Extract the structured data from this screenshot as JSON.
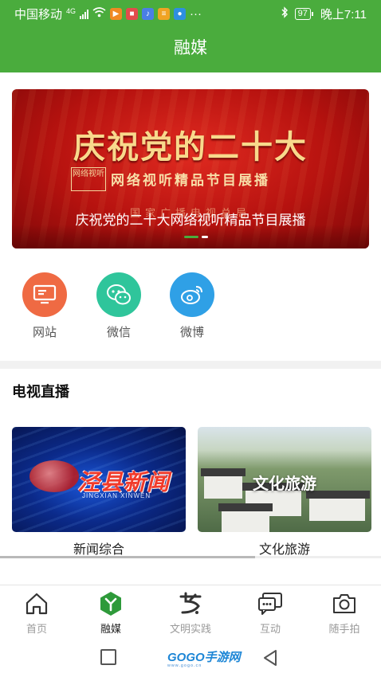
{
  "status_bar": {
    "carrier": "中国移动",
    "network": "4G",
    "battery": "97",
    "time": "晚上7:11",
    "more": "···"
  },
  "header": {
    "title": "融媒"
  },
  "banner": {
    "headline": "庆祝党的二十大",
    "seal_text": "网络视听",
    "subtitle": "网络视听精品节目展播",
    "org": "国家广播电视总局",
    "caption": "庆祝党的二十大网络视听精品节目展播",
    "slide_index": 1,
    "slide_count": 2
  },
  "share": [
    {
      "label": "网站",
      "icon": "monitor-icon",
      "color": "#ef6a43"
    },
    {
      "label": "微信",
      "icon": "wechat-icon",
      "color": "#2fc59b"
    },
    {
      "label": "微博",
      "icon": "weibo-icon",
      "color": "#2fa0e6"
    }
  ],
  "live": {
    "title": "电视直播",
    "channels": [
      {
        "label": "新闻综合",
        "thumb_title": "泾县新闻",
        "thumb_pinyin": "JINGXIAN XINWEN"
      },
      {
        "label": "文化旅游",
        "thumb_title": "文化旅游"
      }
    ]
  },
  "bottom_nav": {
    "active": "融媒",
    "items": [
      {
        "label": "首页",
        "icon": "home-icon"
      },
      {
        "label": "融媒",
        "icon": "media-icon"
      },
      {
        "label": "文明实践",
        "icon": "civilization-icon"
      },
      {
        "label": "互动",
        "icon": "chat-icon"
      },
      {
        "label": "随手拍",
        "icon": "camera-icon"
      }
    ]
  },
  "watermark": {
    "text": "GOGO手游网",
    "url": "www.gogo.cn"
  },
  "colors": {
    "brand": "#4aac3d",
    "active_nav": "#2e9a3a",
    "dot_active": "#4aac3d"
  }
}
